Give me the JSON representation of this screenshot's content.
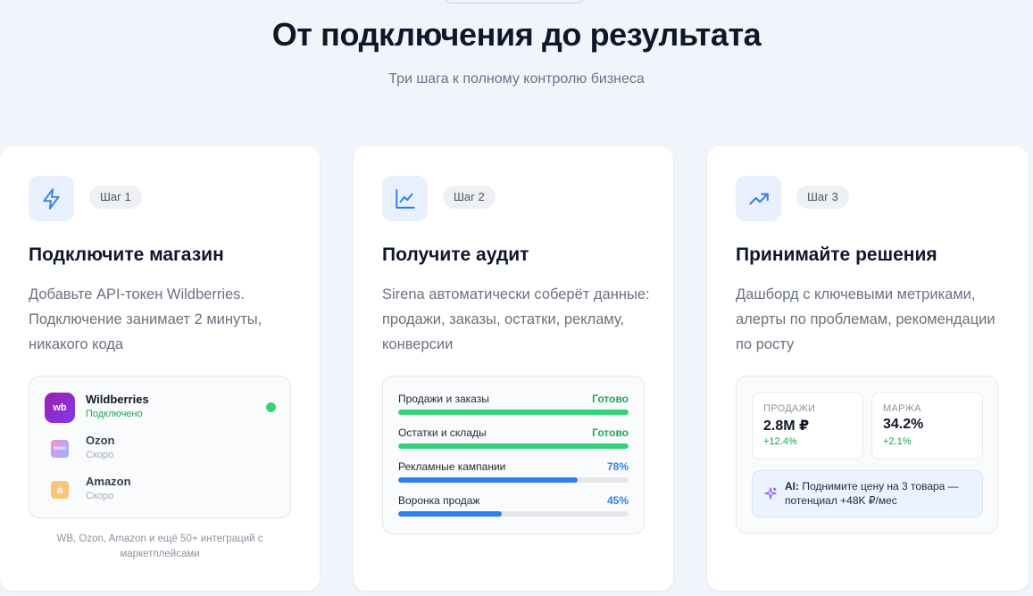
{
  "header": {
    "title": "От подключения до результата",
    "subtitle": "Три шага к полному контролю бизнеса"
  },
  "steps": [
    {
      "badge": "Шаг 1",
      "icon": "lightning-icon",
      "title": "Подключите магазин",
      "description": "Добавьте API-токен Wildberries. Подключение занимает 2 минуты, никакого кода",
      "integrations": [
        {
          "name": "Wildberries",
          "status": "Подключено",
          "status_color": "#22a559",
          "logo": "wb-logo",
          "logo_text": "wb",
          "active": true
        },
        {
          "name": "Ozon",
          "status": "Скоро",
          "status_color": "#a3abb7",
          "logo": "ozon-logo",
          "logo_text": "ozon",
          "active": false
        },
        {
          "name": "Amazon",
          "status": "Скоро",
          "status_color": "#a3abb7",
          "logo": "amazon-logo",
          "logo_text": "a",
          "active": false
        }
      ],
      "note": "WB, Ozon, Amazon и ещё 50+ интеграций с маркетплейсами"
    },
    {
      "badge": "Шаг 2",
      "icon": "line-chart-icon",
      "title": "Получите аудит",
      "description": "Sirena автоматически соберёт данные: продажи, заказы, остатки, рекламу, конверсии",
      "progress": [
        {
          "label": "Продажи и заказы",
          "value": "Готово",
          "percent": 100,
          "color": "#34d37a"
        },
        {
          "label": "Остатки и склады",
          "value": "Готово",
          "percent": 100,
          "color": "#34d37a"
        },
        {
          "label": "Рекламные кампании",
          "value": "78%",
          "percent": 78,
          "color": "#2f80ed"
        },
        {
          "label": "Воронка продаж",
          "value": "45%",
          "percent": 45,
          "color": "#2f80ed"
        }
      ]
    },
    {
      "badge": "Шаг 3",
      "icon": "trending-up-icon",
      "title": "Принимайте решения",
      "description": "Дашборд с ключевыми метриками, алерты по проблемам, рекомендации по росту",
      "metrics": [
        {
          "label": "ПРОДАЖИ",
          "value": "2.8M ₽",
          "delta": "+12.4%"
        },
        {
          "label": "МАРЖА",
          "value": "34.2%",
          "delta": "+2.1%"
        }
      ],
      "ai": {
        "prefix": "AI:",
        "text": "Поднимите цену на 3 товара — потенциал +48K ₽/мес"
      }
    }
  ],
  "colors": {
    "accent": "#2f80ed",
    "success": "#34d37a",
    "success_text": "#22a559",
    "background": "#f1f5fb"
  }
}
